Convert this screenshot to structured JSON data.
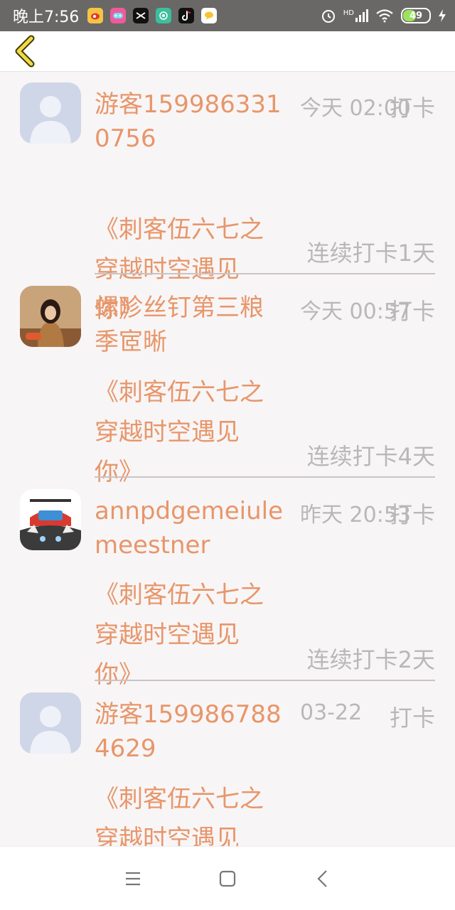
{
  "status_bar": {
    "time": "晚上7:56",
    "hd_label": "HD",
    "battery": "49",
    "app_icons": [
      "weibo-icon",
      "game-icon",
      "capcut-icon",
      "podcast-icon",
      "tiktok-icon",
      "chat-icon"
    ]
  },
  "header": {
    "back_icon": "chevron-left-icon"
  },
  "entries": [
    {
      "name": "游客1599863310756",
      "book": [
        "《刺客伍六七之",
        "穿越时空遇见",
        "你》"
      ],
      "time": "今天 02:00",
      "action": "打卡",
      "streak": "连续打卡1天",
      "avatar": "default-avatar"
    },
    {
      "name": "螺畛丝钉第三粮季宧晰",
      "book": [
        "《刺客伍六七之",
        "穿越时空遇见",
        "你》"
      ],
      "time": "今天 00:57",
      "action": "打卡",
      "streak": "连续打卡4天",
      "avatar": "photo-avatar"
    },
    {
      "name": "annpdgemeiulemeestner",
      "book": [
        "《刺客伍六七之",
        "穿越时空遇见",
        "你》"
      ],
      "time": "昨天 20:53",
      "action": "打卡",
      "streak": "连续打卡2天",
      "avatar": "cat-avatar"
    },
    {
      "name": "游客1599867884629",
      "book": [
        "《刺客伍六七之",
        "穿越时空遇见"
      ],
      "time": "03-22",
      "action": "打卡",
      "streak": "",
      "avatar": "default-avatar"
    }
  ],
  "nav": {
    "menu": "menu-icon",
    "home": "home-icon",
    "back": "back-icon"
  },
  "colors": {
    "accent": "#e7966a",
    "muted": "#b8b8b8",
    "status_bar": "#6a6767",
    "background": "#f8f5f6"
  }
}
